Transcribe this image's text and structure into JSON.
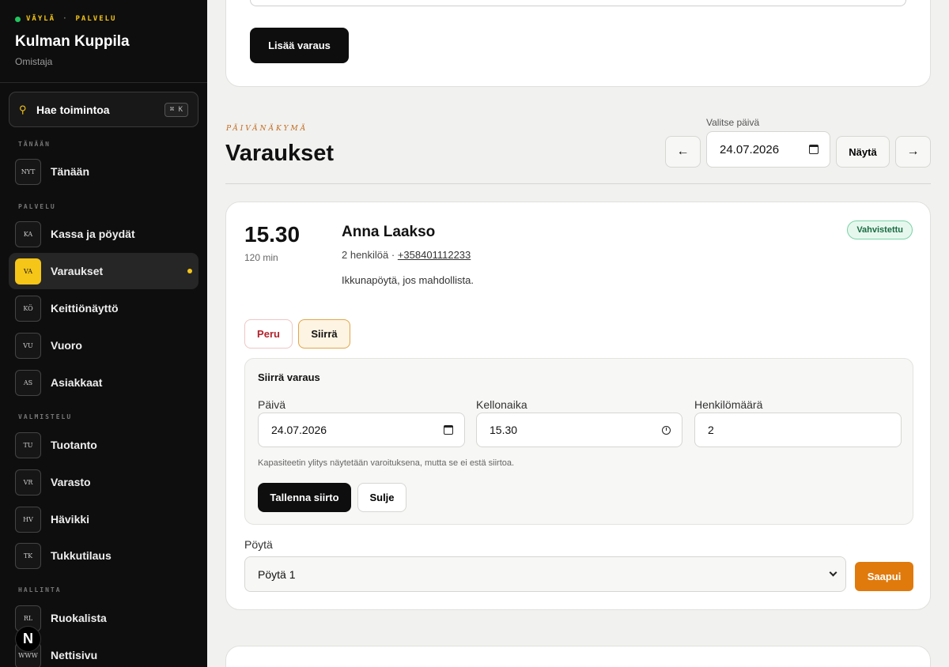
{
  "sidebar": {
    "brand_a": "VÄYLÄ",
    "brand_sep": "·",
    "brand_b": "PALVELU",
    "venue": "Kulman Kuppila",
    "role": "Omistaja",
    "search_label": "Hae toimintoa",
    "search_shortcut": "⌘ K",
    "sections": {
      "today": "TÄNÄÄN",
      "service": "PALVELU",
      "prep": "VALMISTELU",
      "admin": "HALLINTA"
    },
    "items": [
      {
        "badge": "NYT",
        "label": "Tänään"
      },
      {
        "badge": "KA",
        "label": "Kassa ja pöydät"
      },
      {
        "badge": "VA",
        "label": "Varaukset"
      },
      {
        "badge": "KÖ",
        "label": "Keittiönäyttö"
      },
      {
        "badge": "VU",
        "label": "Vuoro"
      },
      {
        "badge": "AS",
        "label": "Asiakkaat"
      },
      {
        "badge": "TU",
        "label": "Tuotanto"
      },
      {
        "badge": "VR",
        "label": "Varasto"
      },
      {
        "badge": "HV",
        "label": "Hävikki"
      },
      {
        "badge": "TK",
        "label": "Tukkutilaus"
      },
      {
        "badge": "RL",
        "label": "Ruokalista"
      },
      {
        "badge": "WWW",
        "label": "Nettisivu"
      }
    ],
    "logo": "N",
    "accent": "#f5c518"
  },
  "top_card": {
    "add_button": "Lisää varaus"
  },
  "header": {
    "eyebrow": "PÄIVÄNÄKYMÄ",
    "title": "Varaukset",
    "date_label": "Valitse päivä",
    "date_value": "24.07.2026",
    "prev": "←",
    "next": "→",
    "show_button": "Näytä"
  },
  "reservation": {
    "time": "15.30",
    "duration": "120 min",
    "guest": "Anna Laakso",
    "party": "2 henkilöä",
    "meta_sep": " · ",
    "phone": "+358401112233",
    "note": "Ikkunapöytä, jos mahdollista.",
    "status": "Vahvistettu",
    "cancel_button": "Peru",
    "move_button": "Siirrä",
    "move_panel": {
      "title": "Siirrä varaus",
      "date_label": "Päivä",
      "date_value": "24.07.2026",
      "time_label": "Kellonaika",
      "time_value": "15.30",
      "people_label": "Henkilömäärä",
      "people_value": "2",
      "hint": "Kapasiteetin ylitys näytetään varoituksena, mutta se ei estä siirtoa.",
      "save_button": "Tallenna siirto",
      "close_button": "Sulje"
    },
    "table_label": "Pöytä",
    "table_value": "Pöytä 1",
    "arrive_button": "Saapui",
    "arrive_color": "#e07a0c"
  }
}
